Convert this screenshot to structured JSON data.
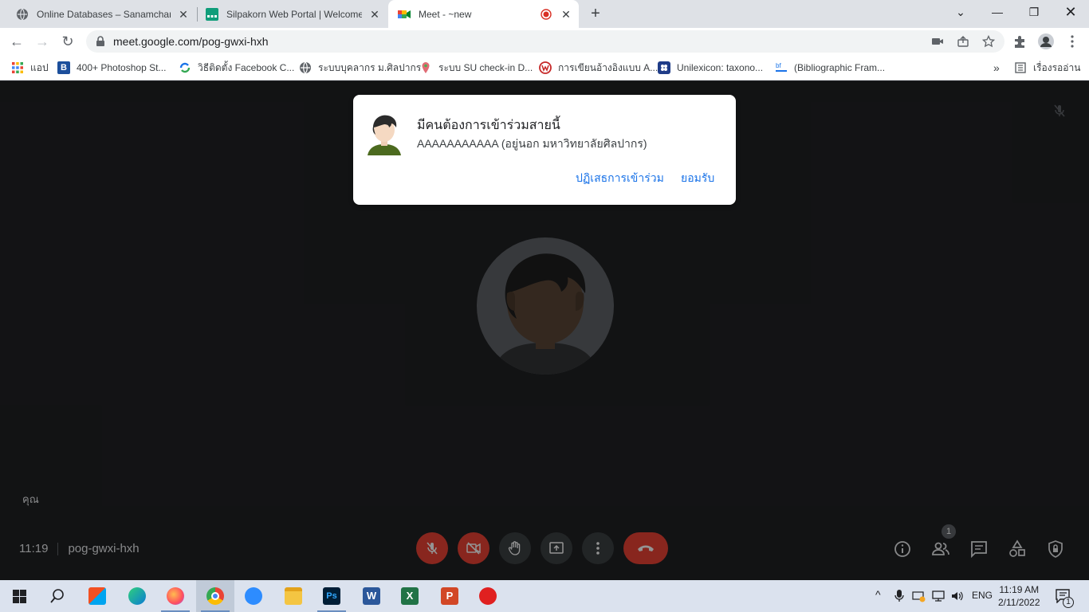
{
  "browser": {
    "tabs": [
      {
        "title": "Online Databases – Sanamchandra",
        "icon": "globe-icon"
      },
      {
        "title": "Silpakorn Web Portal | Welcome",
        "icon": "portal-icon"
      },
      {
        "title": "Meet - ~new",
        "icon": "meet-icon",
        "active": true,
        "recording": true
      }
    ],
    "url": "meet.google.com/pog-gwxi-hxh",
    "bookmarks": [
      {
        "label": "แอป",
        "icon": "apps-grid-icon"
      },
      {
        "label": "400+ Photoshop St...",
        "icon": "b-icon"
      },
      {
        "label": "วิธีติดตั้ง Facebook C...",
        "icon": "refresh-icon"
      },
      {
        "label": "ระบบบุคลากร ม.ศิลปากร",
        "icon": "globe-icon"
      },
      {
        "label": "ระบบ SU check-in D...",
        "icon": "pin-icon"
      },
      {
        "label": "การเขียนอ้างอิงแบบ A...",
        "icon": "w-icon"
      },
      {
        "label": "Unilexicon: taxono...",
        "icon": "unilexicon-icon"
      },
      {
        "label": "(Bibliographic Fram...",
        "icon": "bf-icon"
      }
    ],
    "more_bookmarks": "»",
    "reading_list": "เรื่องรออ่าน"
  },
  "meet": {
    "dialog": {
      "title": "มีคนต้องการเข้าร่วมสายนี้",
      "subtitle": "AAAAAAAAAAA  (อยู่นอก มหาวิทยาลัยศิลปากร)",
      "deny": "ปฏิเสธการเข้าร่วม",
      "admit": "ยอมรับ"
    },
    "self_label": "คุณ",
    "time": "11:19",
    "meeting_code": "pog-gwxi-hxh",
    "participants_count": "1"
  },
  "taskbar": {
    "language": "ENG",
    "time": "11:19 AM",
    "date": "2/11/2022",
    "notification_count": "1"
  },
  "colors": {
    "meet_background": "#202124",
    "end_call": "#ea4335",
    "accent": "#1a73e8"
  }
}
